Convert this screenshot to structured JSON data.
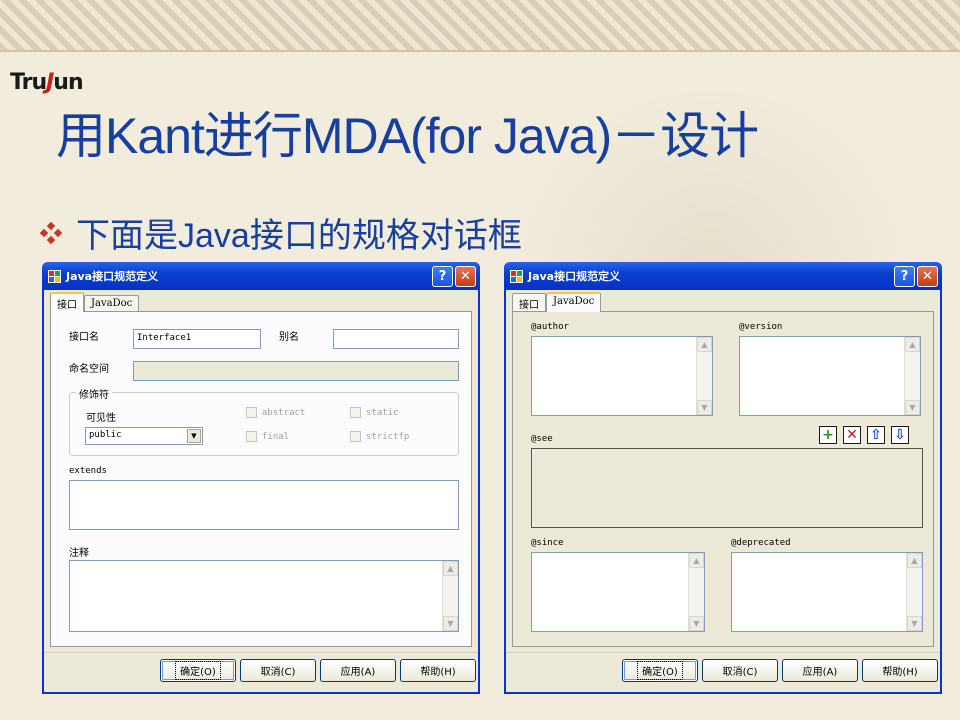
{
  "slide": {
    "logo": {
      "pre": "Tru",
      "mid": "J",
      "post": "un"
    },
    "title": "用Kant进行MDA(for Java)－设计",
    "bullet": "下面是Java接口的规格对话框"
  },
  "colors": {
    "title": "#163fa0",
    "titlebar": "#0a3fd0",
    "dialog_bg": "#ece9d8",
    "bullet": "#c0392b"
  },
  "dialog_left": {
    "title": "Java接口规范定义",
    "help_glyph": "?",
    "close_glyph": "✕",
    "tabs": [
      "接口",
      "JavaDoc"
    ],
    "fields": {
      "interface_name_label": "接口名",
      "interface_name_value": "Interface1",
      "alias_label": "别名",
      "alias_value": "",
      "namespace_label": "命名空间",
      "modifiers_label": "修饰符",
      "visibility_label": "可见性",
      "visibility_value": "public",
      "checkboxes": [
        "abstract",
        "static",
        "final",
        "strictfp"
      ],
      "extends_label": "extends",
      "comment_label": "注释"
    },
    "buttons": [
      "确定(O)",
      "取消(C)",
      "应用(A)",
      "帮助(H)"
    ]
  },
  "dialog_right": {
    "title": "Java接口规范定义",
    "help_glyph": "?",
    "close_glyph": "✕",
    "tabs": [
      "接口",
      "JavaDoc"
    ],
    "fields": {
      "author_label": "@author",
      "version_label": "@version",
      "see_label": "@see",
      "since_label": "@since",
      "deprecated_label": "@deprecated"
    },
    "see_buttons": [
      "add-icon",
      "delete-icon",
      "move-up-icon",
      "move-down-icon"
    ],
    "buttons": [
      "确定(O)",
      "取消(C)",
      "应用(A)",
      "帮助(H)"
    ]
  }
}
